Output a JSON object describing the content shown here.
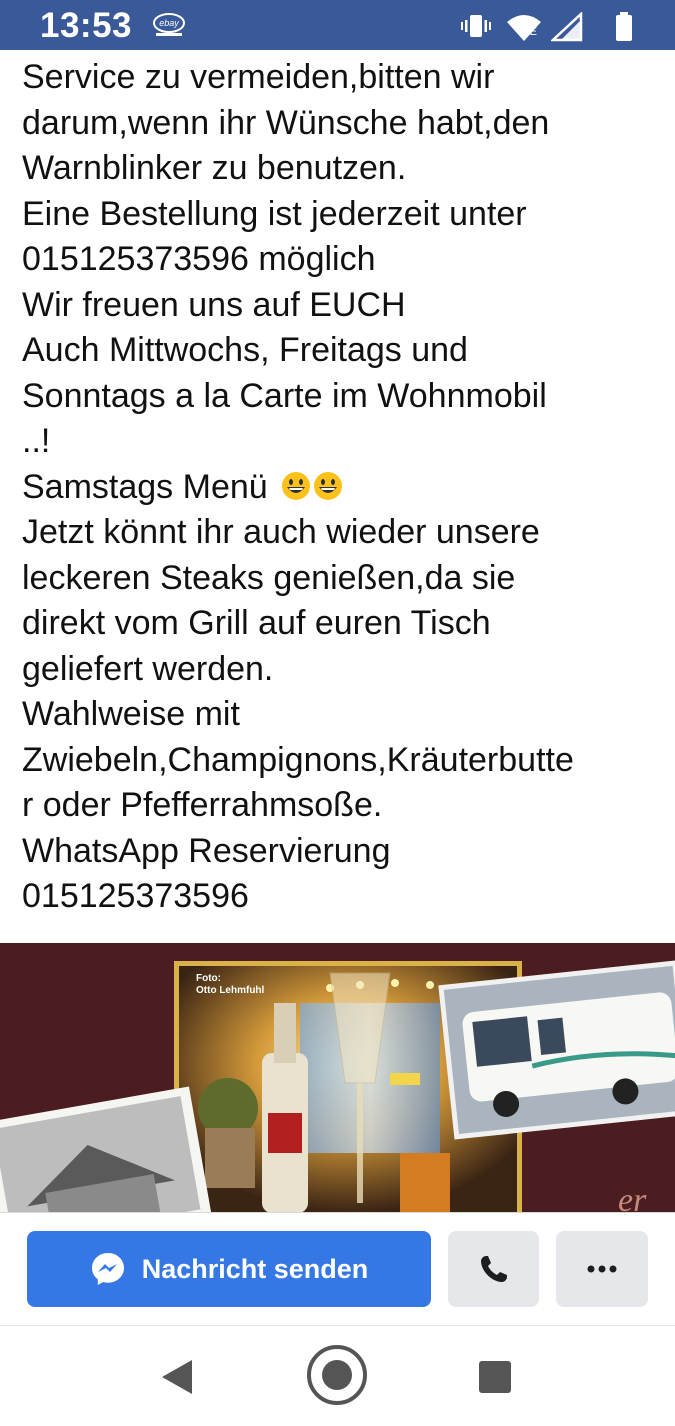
{
  "status_bar": {
    "time": "13:53",
    "notification_icon": "ebay-kleinanzeigen-icon",
    "icons": [
      "vibrate-icon",
      "wifi-icon",
      "signal-icon",
      "battery-icon"
    ],
    "network_label": "E",
    "background_color": "#3a5999"
  },
  "post": {
    "lines": [
      "Service zu vermeiden,bitten wir",
      "darum,wenn ihr Wünsche habt,den",
      "Warnblinker zu benutzen.",
      "Eine Bestellung ist jederzeit unter",
      "015125373596 möglich",
      "Wir freuen uns auf EUCH",
      "Auch Mittwochs, Freitags und",
      "Sonntags a la Carte im Wohnmobil",
      "..!",
      "Samstags Menü",
      "Jetzt könnt ihr auch wieder unsere",
      "leckeren Steaks genießen,da sie",
      "direkt vom Grill auf euren Tisch",
      "geliefert werden.",
      "Wahlweise mit",
      "Zwiebeln,Champignons,Kräuterbutte",
      "r oder Pfefferrahmsoße.",
      "WhatsApp Reservierung",
      "015125373596"
    ],
    "emojis": [
      "grinning-face-emoji",
      "grinning-face-emoji"
    ]
  },
  "image": {
    "caption_line1": "Foto:",
    "caption_line2": "Otto Lehmfuhl",
    "description_icon": "restaurant-collage-image",
    "partial_text": "er"
  },
  "actions": {
    "message_label": "Nachricht senden",
    "message_icon": "messenger-icon",
    "call_icon": "phone-icon",
    "more_icon": "more-dots-icon",
    "accent_color": "#3578e5"
  },
  "nav": {
    "icons": [
      "back-icon",
      "home-icon",
      "recents-icon"
    ]
  }
}
